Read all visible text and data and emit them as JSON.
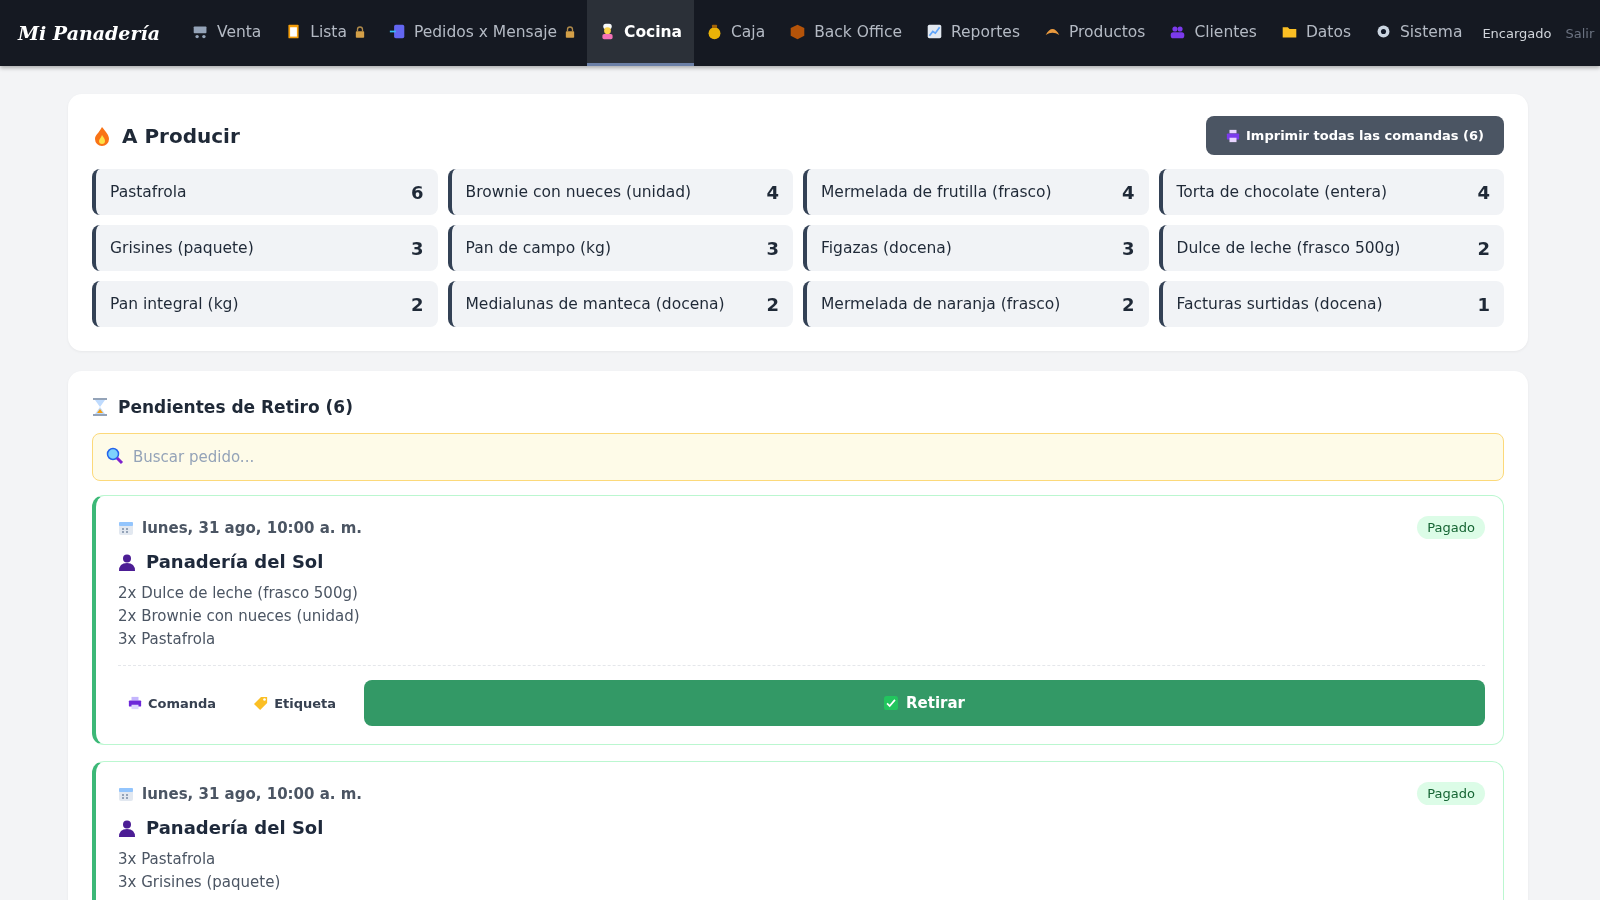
{
  "brand": "Mi Panadería",
  "nav": [
    {
      "label": "Venta",
      "locked": false,
      "selected": false
    },
    {
      "label": "Lista",
      "locked": true,
      "selected": false
    },
    {
      "label": "Pedidos x Mensaje",
      "locked": true,
      "selected": false
    },
    {
      "label": "Cocina",
      "locked": false,
      "selected": true
    },
    {
      "label": "Caja",
      "locked": false,
      "selected": false
    },
    {
      "label": "Back Office",
      "locked": false,
      "selected": false
    },
    {
      "label": "Reportes",
      "locked": false,
      "selected": false
    },
    {
      "label": "Productos",
      "locked": false,
      "selected": false
    },
    {
      "label": "Clientes",
      "locked": false,
      "selected": false
    },
    {
      "label": "Datos",
      "locked": false,
      "selected": false
    },
    {
      "label": "Sistema",
      "locked": false,
      "selected": false
    }
  ],
  "user": "Encargado",
  "logout": "Salir",
  "produce": {
    "title": "A Producir",
    "print_button": "Imprimir todas las comandas (6)",
    "items": [
      {
        "name": "Pastafrola",
        "qty": "6"
      },
      {
        "name": "Brownie con nueces (unidad)",
        "qty": "4"
      },
      {
        "name": "Mermelada de frutilla (frasco)",
        "qty": "4"
      },
      {
        "name": "Torta de chocolate (entera)",
        "qty": "4"
      },
      {
        "name": "Grisines (paquete)",
        "qty": "3"
      },
      {
        "name": "Pan de campo (kg)",
        "qty": "3"
      },
      {
        "name": "Figazas (docena)",
        "qty": "3"
      },
      {
        "name": "Dulce de leche (frasco 500g)",
        "qty": "2"
      },
      {
        "name": "Pan integral (kg)",
        "qty": "2"
      },
      {
        "name": "Medialunas de manteca (docena)",
        "qty": "2"
      },
      {
        "name": "Mermelada de naranja (frasco)",
        "qty": "2"
      },
      {
        "name": "Facturas surtidas (docena)",
        "qty": "1"
      }
    ]
  },
  "pending": {
    "title": "Pendientes de Retiro (6)",
    "search": {
      "placeholder": "Buscar pedido..."
    },
    "orders": [
      {
        "date": "lunes, 31 ago, 10:00 a. m.",
        "customer": "Panadería del Sol",
        "status": "Pagado",
        "paid": true,
        "lines": [
          "2x Dulce de leche (frasco 500g)",
          "2x Brownie con nueces (unidad)",
          "3x Pastafrola"
        ],
        "actions": {
          "ticket": "Comanda",
          "label": "Etiqueta",
          "pickup": "Retirar"
        }
      },
      {
        "date": "lunes, 31 ago, 10:00 a. m.",
        "customer": "Panadería del Sol",
        "status": "Pagado",
        "paid": true,
        "lines": [
          "3x Pastafrola",
          "3x Grisines (paquete)"
        ]
      }
    ]
  }
}
